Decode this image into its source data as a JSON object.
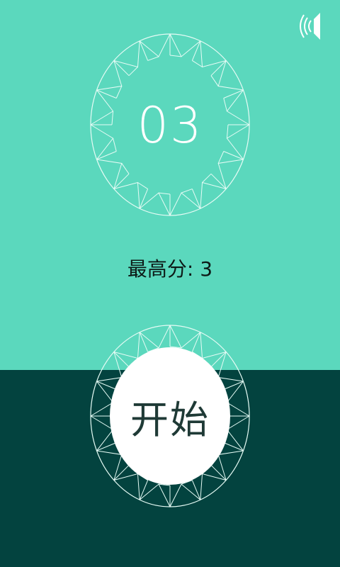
{
  "colors": {
    "top_background": "#5bd8bd",
    "bottom_background": "#03433f",
    "ornament_stroke": "#e6fbf5",
    "score_text": "#ffffff",
    "best_text": "#0d1a17",
    "start_button_fill": "#ffffff",
    "start_label_text": "#1f3a36"
  },
  "sound": {
    "icon": "speaker-on-icon"
  },
  "score": {
    "value": "03"
  },
  "best": {
    "label": "最高分",
    "separator": ": ",
    "value": "3"
  },
  "start": {
    "label": "开始"
  }
}
